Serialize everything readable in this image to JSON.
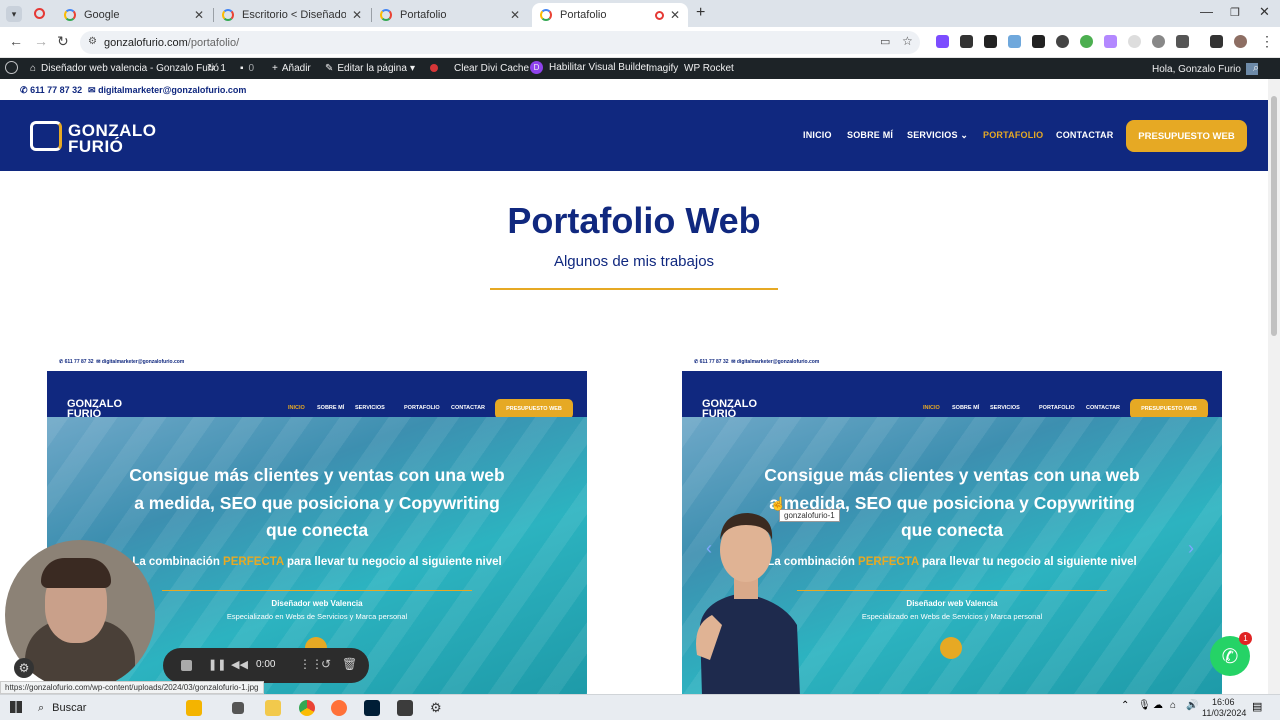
{
  "browser": {
    "tabs": [
      {
        "title": "Google",
        "active": false
      },
      {
        "title": "Escritorio < Diseñador web valencia",
        "active": false
      },
      {
        "title": "Portafolio",
        "active": false
      },
      {
        "title": "Portafolio",
        "active": true
      }
    ],
    "new_tab": "+",
    "url_host": "gonzalofurio.com",
    "url_path": "/portafolio/",
    "status_url": "https://gonzalofurio.com/wp-content/uploads/2024/03/gonzalofurio-1.jpg"
  },
  "wp_admin": {
    "site_name": "Diseñador web valencia - Gonzalo Furió",
    "updates": "1",
    "comments": "0",
    "add_new": "Añadir",
    "edit_page": "Editar la página",
    "clear_cache": "Clear Divi Cache",
    "visual_builder": "Habilitar Visual Builder",
    "imagify": "Imagify",
    "wp_rocket": "WP Rocket",
    "greeting": "Hola, Gonzalo Furio"
  },
  "contact": {
    "phone": "611 77 87 32",
    "email": "digitalmarketer@gonzalofurio.com"
  },
  "site": {
    "logo_line1": "GONZALO",
    "logo_line2": "FURIÓ",
    "menu": {
      "inicio": "INICIO",
      "sobre": "SOBRE MÍ",
      "servicios": "SERVICIOS",
      "portafolio": "PORTAFOLIO",
      "contactar": "CONTACTAR"
    },
    "cta": "PRESUPUESTO WEB"
  },
  "page": {
    "title": "Portafolio Web",
    "subtitle": "Algunos de mis trabajos"
  },
  "thumbnail": {
    "contact_phone": "611 77 87 32",
    "contact_email": "digitalmarketer@gonzalofurio.com",
    "headline": "Consigue más clientes y ventas con una web a medida, SEO que posiciona y Copywriting que conecta",
    "tagline_pre": "La combinación ",
    "tagline_hl": "PERFECTA",
    "tagline_post": " para llevar tu negocio al siguiente nivel",
    "role": "Diseñador web Valencia",
    "specialty": "Especializado en Webs de Servicios y Marca personal"
  },
  "tooltip": "gonzalofurio-1",
  "recorder": {
    "time": "0:00"
  },
  "whatsapp_badge": "1",
  "taskbar": {
    "search": "Buscar",
    "time": "16:06",
    "date": "11/03/2024"
  },
  "colors": {
    "brand_blue": "#10287f",
    "brand_gold": "#e6a924",
    "whatsapp": "#25d366"
  }
}
